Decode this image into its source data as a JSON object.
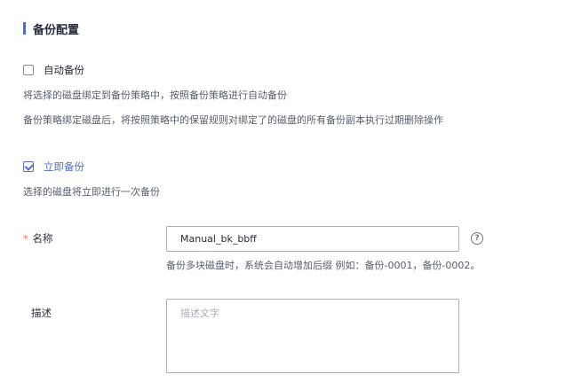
{
  "section": {
    "title": "备份配置"
  },
  "auto_backup": {
    "label": "自动备份",
    "checked": false,
    "desc_line1": "将选择的磁盘绑定到备份策略中，按照备份策略进行自动备份",
    "desc_line2": "备份策略绑定磁盘后，将按照策略中的保留规则对绑定了的磁盘的所有备份副本执行过期删除操作"
  },
  "instant_backup": {
    "label": "立即备份",
    "checked": true,
    "desc": "选择的磁盘将立即进行一次备份"
  },
  "name_field": {
    "required_mark": "*",
    "label": "名称",
    "value": "Manual_bk_bbff",
    "hint": "备份多块磁盘时，系统会自动增加后缀 例如：备份-0001，备份-0002。",
    "help_icon": "question-circle-icon",
    "help_glyph": "?"
  },
  "description_field": {
    "label": "描述",
    "placeholder": "描述文字",
    "value": ""
  },
  "colors": {
    "accent": "#526ecc",
    "required": "#f66f6a",
    "text": "#252b3a",
    "secondary_text": "#575d6c",
    "border": "#adb0b8"
  }
}
